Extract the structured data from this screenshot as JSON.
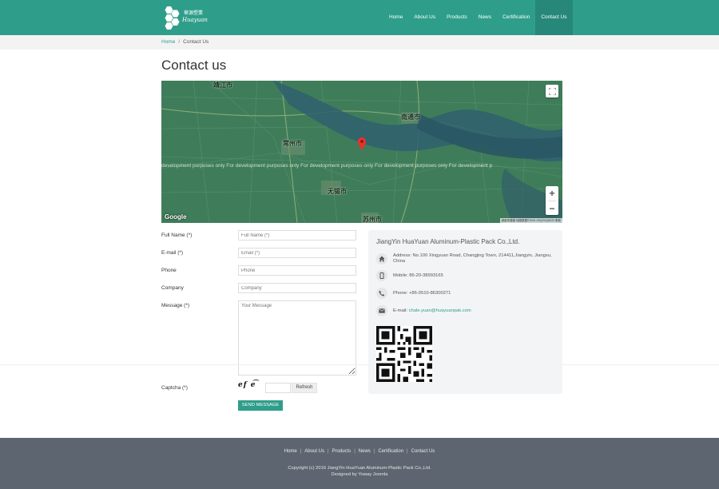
{
  "header": {
    "logo_cn": "華源塑業",
    "logo_script": "Huayuan",
    "nav": [
      "Home",
      "About Us",
      "Products",
      "News",
      "Certification",
      "Contact Us"
    ],
    "active_nav": "Contact Us"
  },
  "breadcrumb": {
    "home": "Home",
    "separator": "/",
    "current": "Contact Us"
  },
  "page_title": "Contact us",
  "map": {
    "watermark": "development purposes only     For development purposes only     For development purposes only     For development purposes only     For development p",
    "cities": [
      "靖江市",
      "南通市",
      "常州市",
      "无锡市",
      "苏州市"
    ],
    "google": "Google",
    "attribution": "键盘快捷键  地图数据©2024 GS(2011)6020  条款",
    "zoom_in": "+",
    "zoom_out": "−"
  },
  "form": {
    "full_name_label": "Full Name (*)",
    "full_name_placeholder": "Full Name (*)",
    "email_label": "E-mail (*)",
    "email_placeholder": "Email (*)",
    "phone_label": "Phone",
    "phone_placeholder": "Phone",
    "company_label": "Company",
    "company_placeholder": "Company",
    "message_label": "Message (*)",
    "message_placeholder": "Your Message",
    "captcha_label": "Captcha (*)",
    "captcha_text": "ef e͡",
    "refresh_label": "Refresh",
    "send_label": "SEND MESSAGE"
  },
  "contact": {
    "company": "JiangYin HuaYuan Aluminum-Plastic Pack Co.,Ltd.",
    "address": "Address: No.100 Xingyuan Road, Changjing Town, 214411,Jiangyin, Jiangsu, China",
    "mobile": "Mobile: 86-20-38993165",
    "phone": "Phone: +86-0510-86300271",
    "email_prefix": "E-mail: ",
    "email": "chale.yuan@huayuanpak.com",
    "icons": [
      "home-icon",
      "mobile-icon",
      "phone-icon",
      "envelope-icon"
    ]
  },
  "footer": {
    "links": [
      "Home",
      "About Us",
      "Products",
      "News",
      "Certification",
      "Contact Us"
    ],
    "copyright": "Copyright (c) 2016 JiangYin HuaYuan Aluminum-Plastic Pack Co.,Ltd.",
    "designed_by": "Designed by Yoway Joomla"
  },
  "colors": {
    "brand": "#2e9e8a",
    "footer": "#5d6670",
    "map_land": "#3f7d5a"
  }
}
